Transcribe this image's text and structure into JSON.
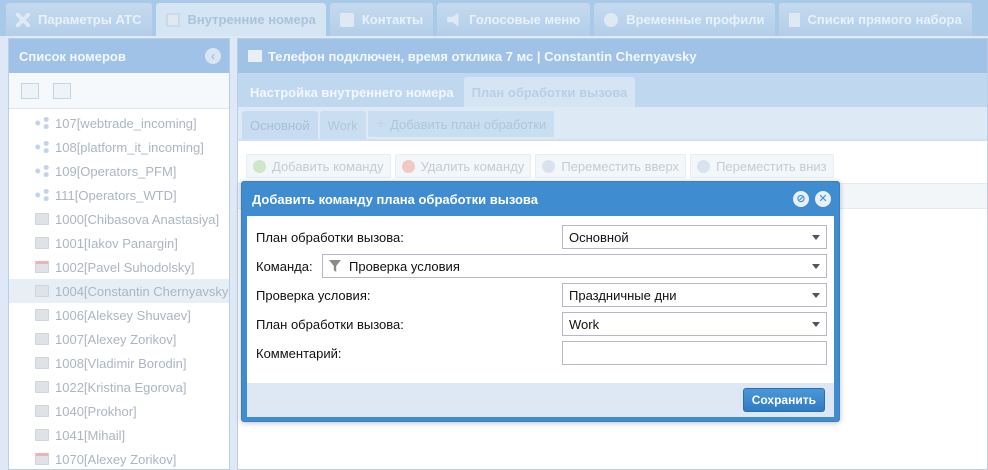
{
  "top_tabs": [
    {
      "label": "Параметры АТС",
      "icon": "tools-icon"
    },
    {
      "label": "Внутренние номера",
      "icon": "book-icon"
    },
    {
      "label": "Контакты",
      "icon": "contact-card-icon"
    },
    {
      "label": "Голосовые меню",
      "icon": "speaker-icon"
    },
    {
      "label": "Временные профили",
      "icon": "clock-icon"
    },
    {
      "label": "Списки прямого набора",
      "icon": "document-icon"
    }
  ],
  "left": {
    "title": "Список номеров",
    "items": [
      "107[webtrade_incoming]",
      "108[platform_it_incoming]",
      "109[Operators_PFM]",
      "111[Operators_WTD]",
      "1000[Chibasova Anastasiya]",
      "1001[Iakov Panargin]",
      "1002[Pavel Suhodolsky]",
      "1004[Constantin Chernyavsky",
      "1006[Aleksey Shuvaev]",
      "1007[Alexey Zorikov]",
      "1008[Vladimir Borodin]",
      "1022[Kristina Egorova]",
      "1040[Prokhor]",
      "1041[Mihail]",
      "1070[Alexey Zorikov]"
    ]
  },
  "main": {
    "status": "Телефон подключен, время отклика 7 мс | Constantin Chernyavsky",
    "subtabs": [
      "Настройка внутреннего номера",
      "План обработки вызова"
    ],
    "plan_tabs": [
      "Основной",
      "Work"
    ],
    "add_plan_label": "Добавить план обработки",
    "commands": {
      "add": "Добавить команду",
      "delete": "Удалить команду",
      "up": "Переместить вверх",
      "down": "Переместить вниз"
    }
  },
  "modal": {
    "title": "Добавить команду плана обработки вызова",
    "fields": {
      "plan_label": "План обработки вызова:",
      "plan_value": "Основной",
      "command_label": "Команда:",
      "command_value": "Проверка условия",
      "condition_label": "Проверка условия:",
      "condition_value": "Праздничные дни",
      "plan2_label": "План обработки вызова:",
      "plan2_value": "Work",
      "comment_label": "Комментарий:",
      "comment_value": ""
    },
    "save_label": "Сохранить"
  }
}
